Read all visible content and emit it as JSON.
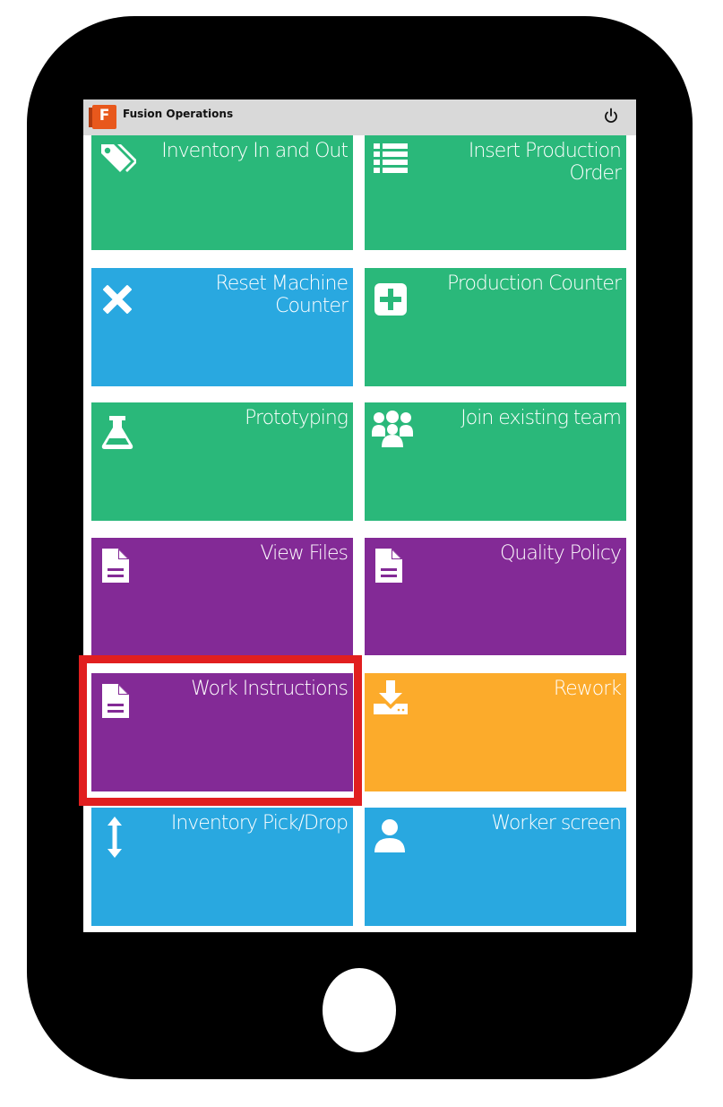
{
  "app": {
    "title": "Fusion Operations",
    "logo_letter": "F"
  },
  "tiles": [
    {
      "label": "Inventory In and Out",
      "icon": "tags-icon",
      "color": "#2ab87a"
    },
    {
      "label": "Insert Production Order",
      "icon": "list-icon",
      "color": "#2ab87a"
    },
    {
      "label": "Reset Machine Counter",
      "icon": "x-icon",
      "color": "#29a8e0"
    },
    {
      "label": "Production Counter",
      "icon": "plus-square-icon",
      "color": "#2ab87a"
    },
    {
      "label": "Prototyping",
      "icon": "flask-icon",
      "color": "#2ab87a"
    },
    {
      "label": "Join existing team",
      "icon": "users-icon",
      "color": "#2ab87a"
    },
    {
      "label": "View Files",
      "icon": "file-icon",
      "color": "#832a96"
    },
    {
      "label": "Quality Policy",
      "icon": "file-icon",
      "color": "#832a96"
    },
    {
      "label": "Work Instructions",
      "icon": "file-icon",
      "color": "#832a96"
    },
    {
      "label": "Rework",
      "icon": "download-icon",
      "color": "#fcab2b"
    },
    {
      "label": "Inventory Pick/Drop",
      "icon": "vertical-arrows-icon",
      "color": "#29a8e0"
    },
    {
      "label": "Worker screen",
      "icon": "user-icon",
      "color": "#29a8e0"
    }
  ],
  "highlight": {
    "target": "Work Instructions",
    "color": "#e11f1f"
  }
}
